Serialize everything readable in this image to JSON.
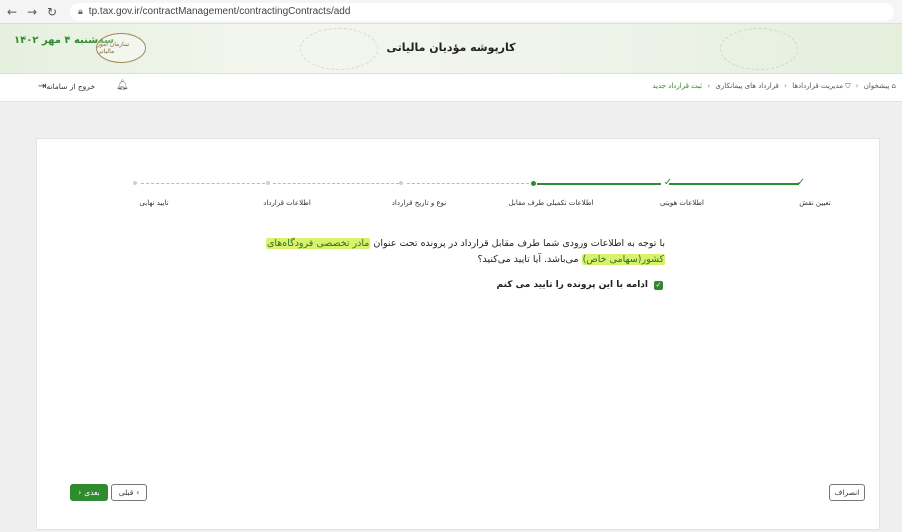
{
  "browser": {
    "url": "tp.tax.gov.ir/contractManagement/contractingContracts/add",
    "back_icon": "arrow-left-icon",
    "forward_icon": "arrow-right-icon",
    "reload_icon": "reload-icon"
  },
  "header": {
    "title": "کارپوشه مؤدیان مالیاتی",
    "date": "سه‌شنبه ۴ مهر ۱۴۰۲",
    "logo_text": "سازمان امور مالیاتی"
  },
  "nav": {
    "breadcrumb": [
      "پیشخوان",
      "مدیریت قراردادها",
      "قرارداد های پیمانکاری",
      "ثبت قرارداد جدید"
    ],
    "logout_label": "خروج از سامانه",
    "bell_icon": "bell-icon"
  },
  "stepper": {
    "steps": [
      {
        "label": "تعیین نقش",
        "status": "done"
      },
      {
        "label": "اطلاعات هویتی",
        "status": "done"
      },
      {
        "label": "اطلاعات تکمیلی طرف مقابل",
        "status": "active"
      },
      {
        "label": "نوع و تاریخ قرارداد",
        "status": "todo"
      },
      {
        "label": "اطلاعات قرارداد",
        "status": "todo"
      },
      {
        "label": "تایید نهایی",
        "status": "todo"
      }
    ]
  },
  "message": {
    "part1": "با توجه به اطلاعات ورودی شما طرف مقابل قرارداد در پرونده تحت عنوان",
    "highlight1": "مادر تخصصی فرودگاه‌های",
    "highlight2": "کشور(سهامی خاص)",
    "part2": "می‌باشد. آیا تایید می‌کنید؟"
  },
  "confirm": {
    "label": "ادامه با این پرونده را تایید می کنم",
    "checked": true
  },
  "buttons": {
    "next": "بعدی",
    "prev": "قبلی",
    "cancel": "انصراف"
  },
  "colors": {
    "accent": "#2e8b2e",
    "highlight": "#d8f26c"
  }
}
